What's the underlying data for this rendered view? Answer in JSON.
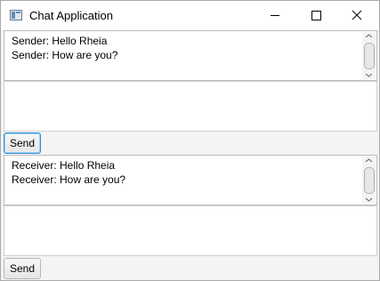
{
  "window": {
    "title": "Chat Application"
  },
  "sender_panel": {
    "messages": [
      "Sender: Hello Rheia",
      "Sender: How are you?"
    ],
    "input_value": "",
    "send_label": "Send"
  },
  "receiver_panel": {
    "messages": [
      "Receiver: Hello Rheia",
      "Receiver: How are you?"
    ],
    "input_value": "",
    "send_label": "Send"
  },
  "icons": {
    "app": "app-window-icon",
    "minimize": "minimize-icon",
    "maximize": "maximize-icon",
    "close": "close-icon"
  },
  "colors": {
    "focus_border": "#2a8fd6",
    "window_background": "#f4f4f4"
  }
}
